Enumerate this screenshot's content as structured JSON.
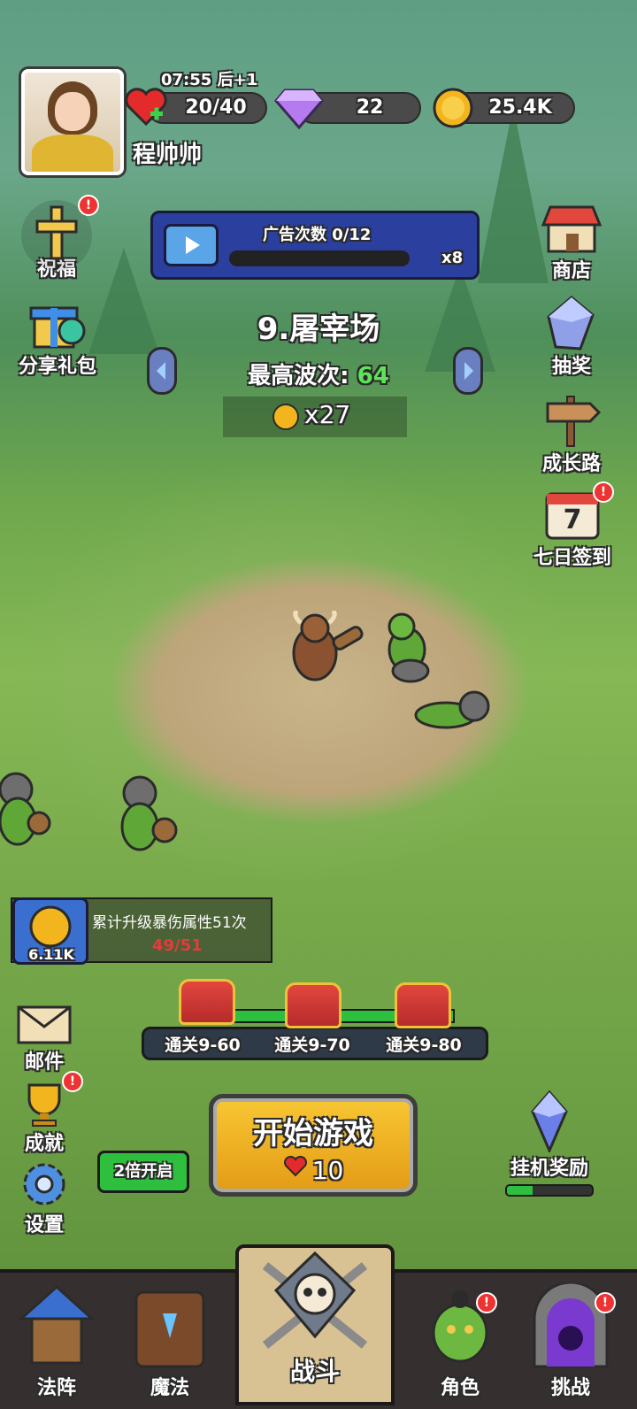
{
  "header": {
    "time": "07:55",
    "time_suffix": "后+1",
    "player_name": "程帅帅",
    "energy": "20/40",
    "gems": "22",
    "coins": "25.4K"
  },
  "ad_banner": {
    "label": "广告次数",
    "count": "0/12",
    "multiplier": "x8",
    "progress_fraction": 0.0
  },
  "level": {
    "name": "9.屠宰场",
    "best_wave_label": "最高波次:",
    "best_wave_value": "64",
    "reward": "x27"
  },
  "left_menu": {
    "blessing": "祝福",
    "share_gift": "分享礼包",
    "mail": "邮件",
    "achievement": "成就",
    "settings": "设置"
  },
  "right_menu": {
    "shop": "商店",
    "lottery": "抽奖",
    "growth": "成长路",
    "checkin": "七日签到",
    "checkin_day": "7",
    "idle_reward": "挂机奖励",
    "idle_progress_fraction": 0.3
  },
  "quest": {
    "text": "累计升级暴伤属性51次",
    "progress": "49/51",
    "reward": "6.11K"
  },
  "milestones": [
    "通关9-60",
    "通关9-70",
    "通关9-80"
  ],
  "double_button": "2倍开启",
  "start": {
    "label": "开始游戏",
    "cost": "10"
  },
  "badges": {
    "alert": "!"
  },
  "bottom_nav": {
    "formation": "法阵",
    "magic": "魔法",
    "battle": "战斗",
    "character": "角色",
    "challenge": "挑战"
  },
  "colors": {
    "best_wave": "#5fe35a",
    "quest_progress": "#e83a3a",
    "double_button": "#2fbf3e"
  }
}
